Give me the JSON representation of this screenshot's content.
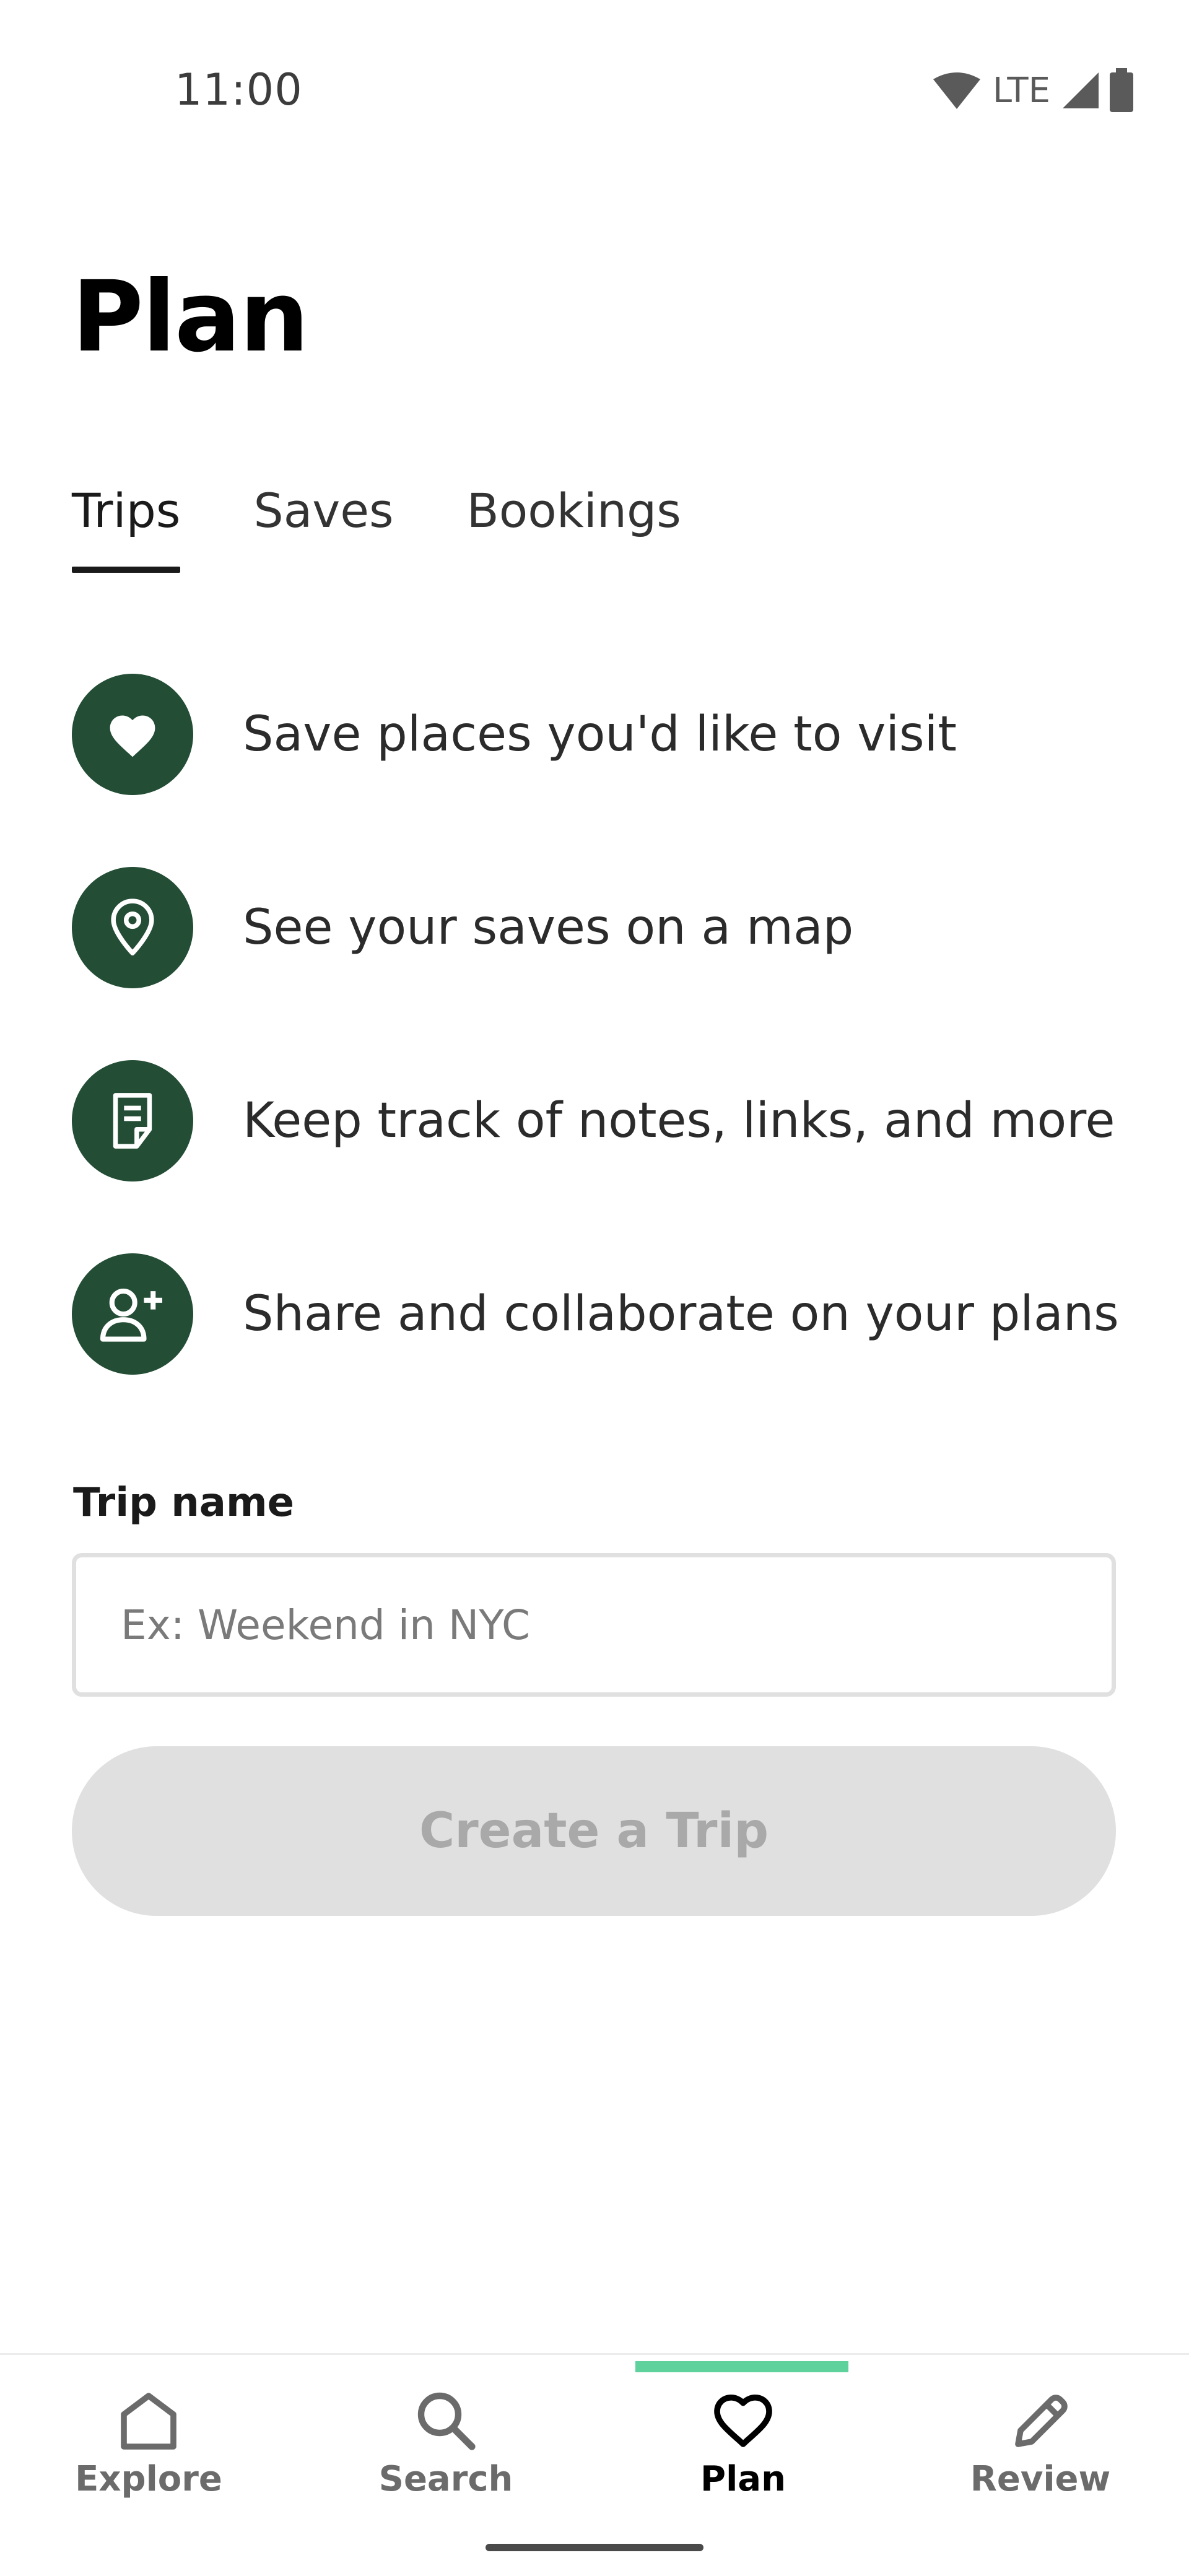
{
  "status_bar": {
    "time": "11:00",
    "network": "LTE",
    "icons": [
      "wifi-icon",
      "signal-icon",
      "battery-icon"
    ]
  },
  "page": {
    "title": "Plan"
  },
  "tabs": [
    {
      "label": "Trips",
      "active": true
    },
    {
      "label": "Saves",
      "active": false
    },
    {
      "label": "Bookings",
      "active": false
    }
  ],
  "features": [
    {
      "icon": "heart-icon",
      "text": "Save places you'd like to visit"
    },
    {
      "icon": "map-pin-icon",
      "text": "See your saves on a map"
    },
    {
      "icon": "note-icon",
      "text": "Keep track of notes, links, and more"
    },
    {
      "icon": "add-user-icon",
      "text": "Share and collaborate on your plans"
    }
  ],
  "trip_form": {
    "label": "Trip name",
    "value": "",
    "placeholder": "Ex: Weekend in NYC",
    "submit_label": "Create a Trip"
  },
  "bottom_nav": [
    {
      "icon": "home-icon",
      "label": "Explore",
      "active": false
    },
    {
      "icon": "search-icon",
      "label": "Search",
      "active": false
    },
    {
      "icon": "heart-icon",
      "label": "Plan",
      "active": true
    },
    {
      "icon": "pencil-icon",
      "label": "Review",
      "active": false
    }
  ],
  "colors": {
    "accent": "#234d35",
    "active_indicator": "#5ed19d",
    "disabled_button_bg": "#e0e0e0",
    "disabled_button_text": "#a9a9a9"
  }
}
